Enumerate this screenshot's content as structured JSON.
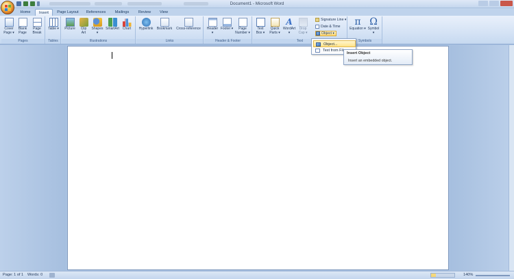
{
  "window": {
    "title": "Document1 - Microsoft Word"
  },
  "tabs": [
    "Home",
    "Insert",
    "Page Layout",
    "References",
    "Mailings",
    "Review",
    "View"
  ],
  "active_tab": "Insert",
  "ribbon": {
    "pages": {
      "label": "Pages",
      "cover_page": "Cover Page ▾",
      "blank_page": "Blank Page",
      "page_break": "Page Break"
    },
    "tables": {
      "label": "Tables",
      "table": "Table ▾"
    },
    "illustrations": {
      "label": "Illustrations",
      "picture": "Picture",
      "clip_art": "Clip Art",
      "shapes": "Shapes ▾",
      "smartart": "SmartArt",
      "chart": "Chart"
    },
    "links": {
      "label": "Links",
      "hyperlink": "Hyperlink",
      "bookmark": "Bookmark",
      "cross_reference": "Cross-reference"
    },
    "header_footer": {
      "label": "Header & Footer",
      "header": "Header ▾",
      "footer": "Footer ▾",
      "page_number": "Page Number ▾"
    },
    "text": {
      "label": "Text",
      "text_box": "Text Box ▾",
      "quick_parts": "Quick Parts ▾",
      "wordart": "WordArt ▾",
      "drop_cap": "Drop Cap ▾",
      "signature_line": "Signature Line ▾",
      "date_time": "Date & Time",
      "object": "Object ▾"
    },
    "symbols": {
      "label": "Symbols",
      "equation": "Equation ▾",
      "symbol": "Symbol ▾",
      "equation_glyph": "π",
      "symbol_glyph": "Ω"
    }
  },
  "dropdown": {
    "items": [
      "Object...",
      "Text from File..."
    ]
  },
  "tooltip": {
    "title": "Insert Object",
    "body": "Insert an embedded object."
  },
  "status": {
    "page": "Page: 1 of 1",
    "words": "Words: 0",
    "zoom": "140%"
  },
  "colors": {
    "accent_highlight": "#ffe38a",
    "ribbon_bg": "#d5e3f5",
    "workspace": "#a9c2e2"
  }
}
